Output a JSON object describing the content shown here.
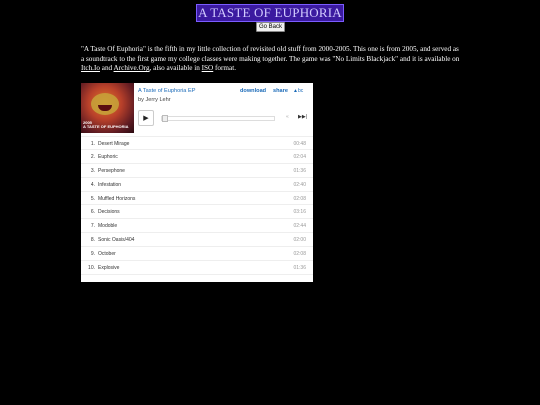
{
  "header": {
    "title": "A TASTE OF EUPHORIA",
    "back_label": "Go Back"
  },
  "description": {
    "text_before": "\"A Taste Of Euphoria\" is the fifth in my little collection of revisited old stuff from 2000-2005. This one is from 2005, and served as a soundtrack to the first game my college classes were making together. The game was \"No Limits Blackjack\" and it is available on ",
    "link_itch": "Itch.Io",
    "text_and": " and ",
    "link_archive": "Archive.Org",
    "text_also": ", also available in ",
    "link_iso": "ISO",
    "text_end": " format."
  },
  "player": {
    "cover_caption_line1": "2005",
    "cover_caption_line2": "A TASTE OF EUPHORIA",
    "album_title": "A Taste of Euphoria EP",
    "artist": "by Jerry Lehr",
    "download_label": "download",
    "share_label": "share",
    "logo_text": "▲bc",
    "play_icon": "▶",
    "prev_icon": "«",
    "next_icon": "▶▶|",
    "progress": 0,
    "tracks": [
      {
        "num": "1.",
        "name": "Desert Mirage",
        "dur": "00:48"
      },
      {
        "num": "2.",
        "name": "Euphoric",
        "dur": "02:04"
      },
      {
        "num": "3.",
        "name": "Persephone",
        "dur": "01:36"
      },
      {
        "num": "4.",
        "name": "Infestation",
        "dur": "02:40"
      },
      {
        "num": "5.",
        "name": "Muffled Horizons",
        "dur": "02:08"
      },
      {
        "num": "6.",
        "name": "Decisions",
        "dur": "03:16"
      },
      {
        "num": "7.",
        "name": "Modoble",
        "dur": "02:44"
      },
      {
        "num": "8.",
        "name": "Sonic Oasis/404",
        "dur": "02:00"
      },
      {
        "num": "9.",
        "name": "October",
        "dur": "02:08"
      },
      {
        "num": "10.",
        "name": "Explosive",
        "dur": "01:36"
      }
    ]
  },
  "colors": {
    "title_bg": "#3b1aa0",
    "link_blue": "#1a6ab8"
  }
}
